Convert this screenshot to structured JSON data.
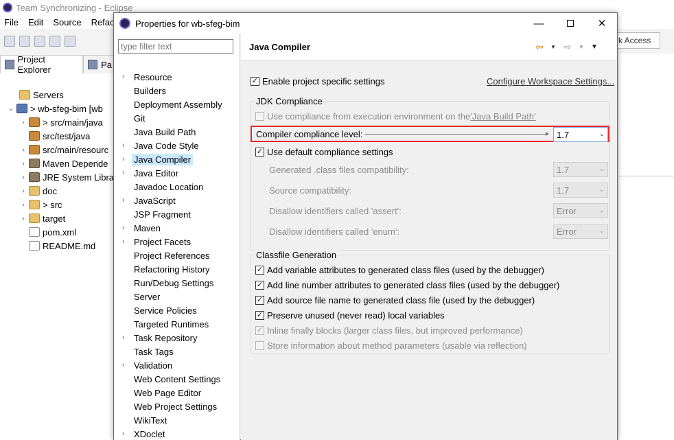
{
  "eclipse": {
    "title": "Team Synchronizing - Eclipse",
    "menu": [
      "File",
      "Edit",
      "Source",
      "Refact"
    ],
    "quick_access": "k Access",
    "tabs": [
      {
        "label": "Project Explorer"
      },
      {
        "label": "Pa"
      }
    ],
    "tree": [
      {
        "label": "Servers",
        "icon": "folder-icon"
      },
      {
        "label": "> wb-sfeg-bim  [wb",
        "icon": "project-icon"
      },
      {
        "label": "> src/main/java",
        "icon": "package-icon"
      },
      {
        "label": "src/test/java",
        "icon": "package-icon"
      },
      {
        "label": "src/main/resourc",
        "icon": "package-icon"
      },
      {
        "label": "Maven Depende",
        "icon": "library-icon"
      },
      {
        "label": "JRE System Libra",
        "icon": "library-icon"
      },
      {
        "label": "doc",
        "icon": "folder-icon"
      },
      {
        "label": "> src",
        "icon": "folder-icon"
      },
      {
        "label": "target",
        "icon": "folder-icon"
      },
      {
        "label": "pom.xml",
        "icon": "file-icon"
      },
      {
        "label": "README.md",
        "icon": "file-icon"
      }
    ]
  },
  "dialog": {
    "title": "Properties for wb-sfeg-bim",
    "filter_placeholder": "type filter text",
    "nav": [
      {
        "label": "Resource",
        "expandable": true
      },
      {
        "label": "Builders",
        "expandable": false
      },
      {
        "label": "Deployment Assembly",
        "expandable": false
      },
      {
        "label": "Git",
        "expandable": false
      },
      {
        "label": "Java Build Path",
        "expandable": false
      },
      {
        "label": "Java Code Style",
        "expandable": true
      },
      {
        "label": "Java Compiler",
        "expandable": true,
        "selected": true
      },
      {
        "label": "Java Editor",
        "expandable": true
      },
      {
        "label": "Javadoc Location",
        "expandable": false
      },
      {
        "label": "JavaScript",
        "expandable": true
      },
      {
        "label": "JSP Fragment",
        "expandable": false
      },
      {
        "label": "Maven",
        "expandable": true
      },
      {
        "label": "Project Facets",
        "expandable": true
      },
      {
        "label": "Project References",
        "expandable": false
      },
      {
        "label": "Refactoring History",
        "expandable": false
      },
      {
        "label": "Run/Debug Settings",
        "expandable": false
      },
      {
        "label": "Server",
        "expandable": false
      },
      {
        "label": "Service Policies",
        "expandable": false
      },
      {
        "label": "Targeted Runtimes",
        "expandable": false
      },
      {
        "label": "Task Repository",
        "expandable": true
      },
      {
        "label": "Task Tags",
        "expandable": false
      },
      {
        "label": "Validation",
        "expandable": true
      },
      {
        "label": "Web Content Settings",
        "expandable": false
      },
      {
        "label": "Web Page Editor",
        "expandable": false
      },
      {
        "label": "Web Project Settings",
        "expandable": false
      },
      {
        "label": "WikiText",
        "expandable": false
      },
      {
        "label": "XDoclet",
        "expandable": true
      }
    ],
    "page": {
      "title": "Java Compiler",
      "enable_project_specific": {
        "label": "Enable project specific settings",
        "checked": true
      },
      "configure_workspace_link": "Configure Workspace Settings...",
      "jdk_group": {
        "title": "JDK Compliance",
        "use_env_prefix": "Use compliance from execution environment on the ",
        "use_env_link": "'Java Build Path'",
        "use_env_checked": false,
        "compliance_label": "Compiler compliance level:",
        "compliance_value": "1.7",
        "use_default": {
          "label": "Use default compliance settings",
          "checked": true
        },
        "settings": [
          {
            "label": "Generated .class files compatibility:",
            "value": "1.7"
          },
          {
            "label": "Source compatibility:",
            "value": "1.7"
          },
          {
            "label": "Disallow identifiers called 'assert':",
            "value": "Error"
          },
          {
            "label": "Disallow identifiers called 'enum':",
            "value": "Error"
          }
        ]
      },
      "classfile_group": {
        "title": "Classfile Generation",
        "options": [
          {
            "label": "Add variable attributes to generated class files (used by the debugger)",
            "checked": true,
            "enabled": true
          },
          {
            "label": "Add line number attributes to generated class files (used by the debugger)",
            "checked": true,
            "enabled": true
          },
          {
            "label": "Add source file name to generated class file (used by the debugger)",
            "checked": true,
            "enabled": true
          },
          {
            "label": "Preserve unused (never read) local variables",
            "checked": true,
            "enabled": true
          },
          {
            "label": "Inline finally blocks (larger class files, but improved performance)",
            "checked": true,
            "enabled": false
          },
          {
            "label": "Store information about method parameters (usable via reflection)",
            "checked": false,
            "enabled": false
          }
        ]
      }
    }
  },
  "colors": {
    "highlight_border": "#e8262b",
    "selection": "#cce8ff",
    "back_arrow": "#d28a12"
  }
}
